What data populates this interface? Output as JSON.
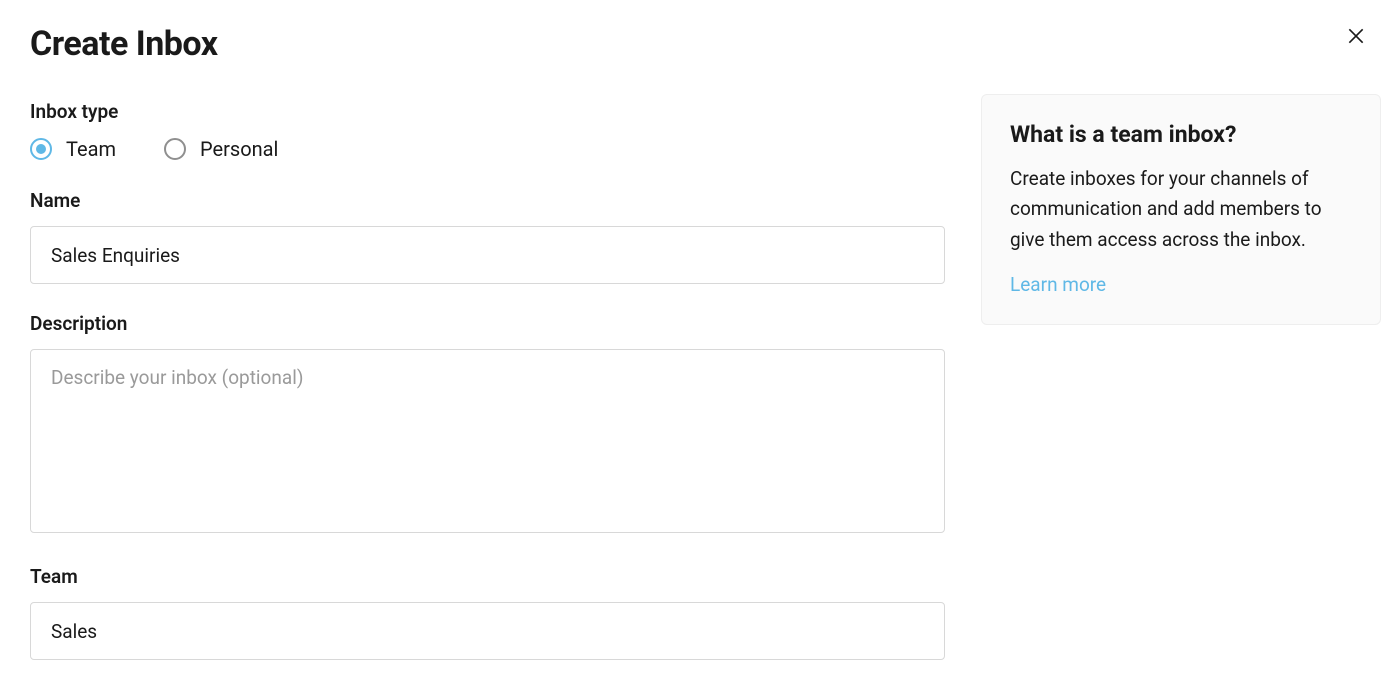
{
  "page": {
    "title": "Create Inbox"
  },
  "form": {
    "inboxType": {
      "label": "Inbox type",
      "options": {
        "team": "Team",
        "personal": "Personal"
      },
      "selected": "team"
    },
    "name": {
      "label": "Name",
      "value": "Sales Enquiries"
    },
    "description": {
      "label": "Description",
      "placeholder": "Describe your inbox (optional)",
      "value": ""
    },
    "team": {
      "label": "Team",
      "value": "Sales"
    }
  },
  "infoPanel": {
    "title": "What is a team inbox?",
    "body": "Create inboxes for your channels of communication and add members to give them access across the inbox.",
    "linkText": "Learn more"
  }
}
